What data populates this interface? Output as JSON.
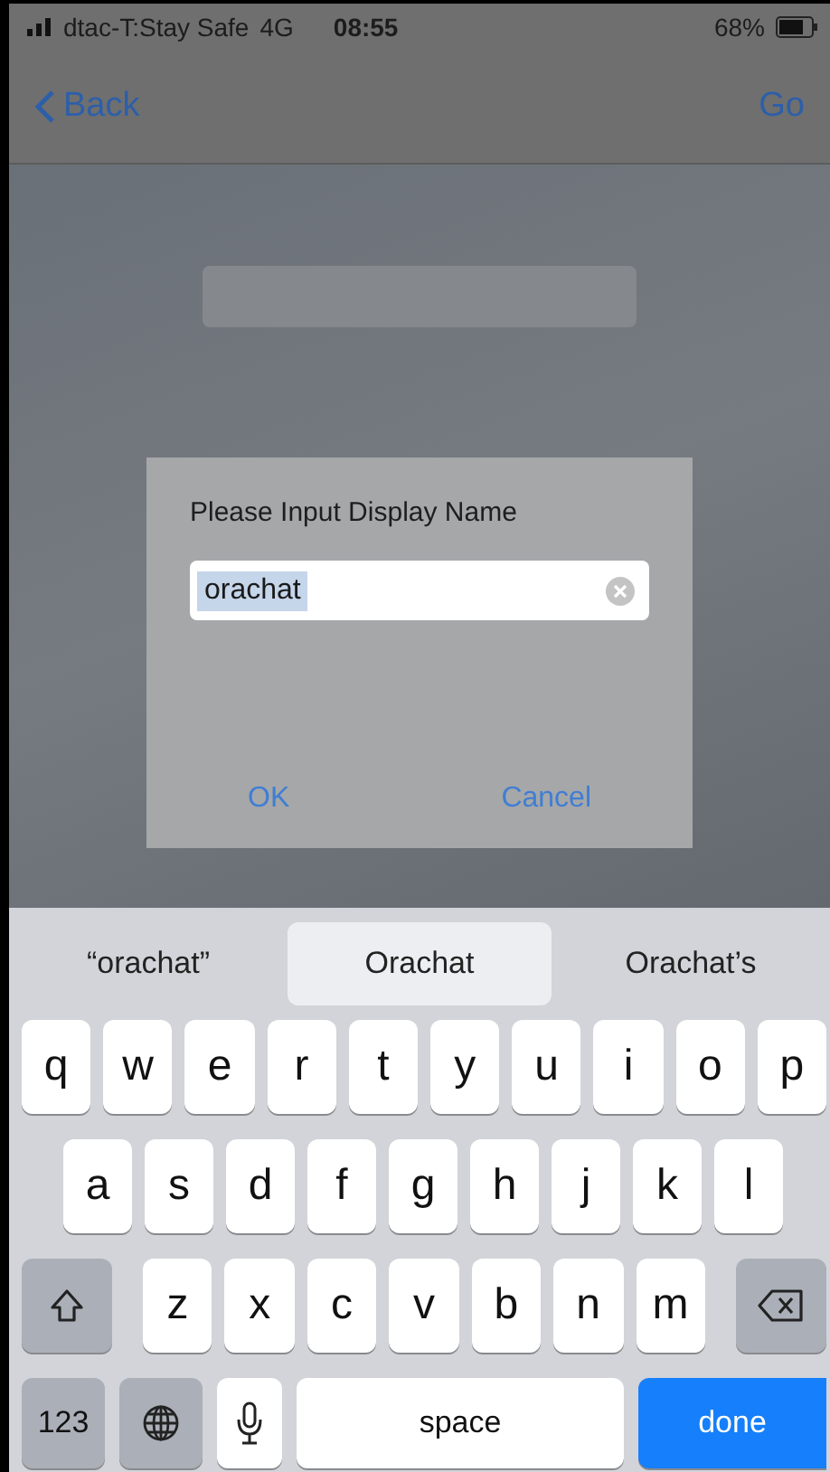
{
  "status_bar": {
    "carrier": "dtac-T:Stay Safe",
    "network": "4G",
    "time": "08:55",
    "battery": "68%"
  },
  "nav_bar": {
    "back": "Back",
    "action": "Go"
  },
  "dialog": {
    "title": "Please Input Display Name",
    "input": {
      "value": "orachat",
      "value_selected": true
    },
    "buttons": [
      "OK",
      "Cancel"
    ]
  },
  "suggestions": [
    {
      "label": "“orachat”",
      "selected": false
    },
    {
      "label": "Orachat",
      "selected": true
    },
    {
      "label": "Orachat’s",
      "selected": false
    }
  ],
  "keyboard": {
    "rows": [
      {
        "keys": [
          {
            "kind": "letter",
            "label": "q"
          },
          {
            "kind": "letter",
            "label": "w"
          },
          {
            "kind": "letter",
            "label": "e"
          },
          {
            "kind": "letter",
            "label": "r"
          },
          {
            "kind": "letter",
            "label": "t"
          },
          {
            "kind": "letter",
            "label": "y"
          },
          {
            "kind": "letter",
            "label": "u"
          },
          {
            "kind": "letter",
            "label": "i"
          },
          {
            "kind": "letter",
            "label": "o"
          },
          {
            "kind": "letter",
            "label": "p"
          }
        ]
      },
      {
        "keys": [
          {
            "kind": "letter",
            "label": "a"
          },
          {
            "kind": "letter",
            "label": "s"
          },
          {
            "kind": "letter",
            "label": "d"
          },
          {
            "kind": "letter",
            "label": "f"
          },
          {
            "kind": "letter",
            "label": "g"
          },
          {
            "kind": "letter",
            "label": "h"
          },
          {
            "kind": "letter",
            "label": "j"
          },
          {
            "kind": "letter",
            "label": "k"
          },
          {
            "kind": "letter",
            "label": "l"
          }
        ]
      },
      {
        "keys": [
          {
            "kind": "shift"
          },
          {
            "kind": "letter",
            "label": "z"
          },
          {
            "kind": "letter",
            "label": "x"
          },
          {
            "kind": "letter",
            "label": "c"
          },
          {
            "kind": "letter",
            "label": "v"
          },
          {
            "kind": "letter",
            "label": "b"
          },
          {
            "kind": "letter",
            "label": "n"
          },
          {
            "kind": "letter",
            "label": "m"
          },
          {
            "kind": "delete"
          }
        ]
      },
      {
        "keys": [
          {
            "kind": "mode",
            "label": "123"
          },
          {
            "kind": "globe"
          },
          {
            "kind": "mic"
          },
          {
            "kind": "space",
            "label": "space"
          },
          {
            "kind": "done",
            "label": "done"
          }
        ]
      }
    ]
  }
}
